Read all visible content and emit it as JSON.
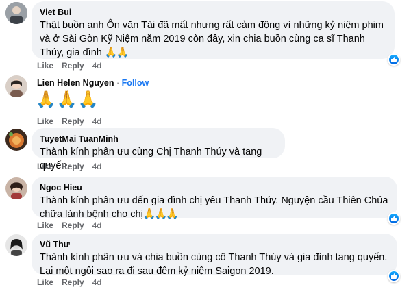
{
  "comments": [
    {
      "name": "Viet Bui",
      "text": "Thật buồn anh Ôn văn Tài đã mất nhưng rất cảm động vì những kỷ niệm phim và ở Sài Gòn Kỹ Niệm năm 2019 còn đây, xin chia buồn cùng ca sĩ Thanh Thúy, gia đình",
      "emoji": "🙏🙏",
      "like_label": "Like",
      "reply_label": "Reply",
      "time": "4d",
      "avatar_color": "#8a8f96"
    },
    {
      "name": "Lien Helen Nguyen",
      "follow_label": "Follow",
      "emoji": "🙏🙏🙏",
      "like_label": "Like",
      "reply_label": "Reply",
      "time": "4d",
      "avatar_color": "#b8a9a0"
    },
    {
      "name": "TuyetMai TuanMinh",
      "text": "Thành kính phân ưu cùng Chị Thanh Thúy và tang quyến.",
      "like_label": "Like",
      "reply_label": "Reply",
      "time": "4d",
      "avatar_color": "#c7642f"
    },
    {
      "name": "Ngoc Hieu",
      "text": "Thành kính phân ưu đến gia đình chị yêu Thanh Thúy. Nguyện cầu Thiên Chúa chữa lành bệnh cho chị",
      "emoji": "🙏🙏🙏",
      "like_label": "Like",
      "reply_label": "Reply",
      "time": "4d",
      "avatar_color": "#9c6b5a"
    },
    {
      "name": "Vũ Thư",
      "text": "Thành kính phân ưu và chia buồn cùng cô Thanh Thúy và gia đình tang quyến. Lại một ngôi sao ra đi sau đêm kỷ niệm Saigon 2019.",
      "like_label": "Like",
      "reply_label": "Reply",
      "time": "4d",
      "avatar_color": "#5a5a5a"
    }
  ],
  "colors": {
    "bubble": "#f0f2f5",
    "link": "#1877f2",
    "meta": "#65676b",
    "like_badge": "#1877f2"
  },
  "icons": {
    "like_badge": "thumbs-up-icon",
    "emoji": "folded-hands-icon"
  }
}
